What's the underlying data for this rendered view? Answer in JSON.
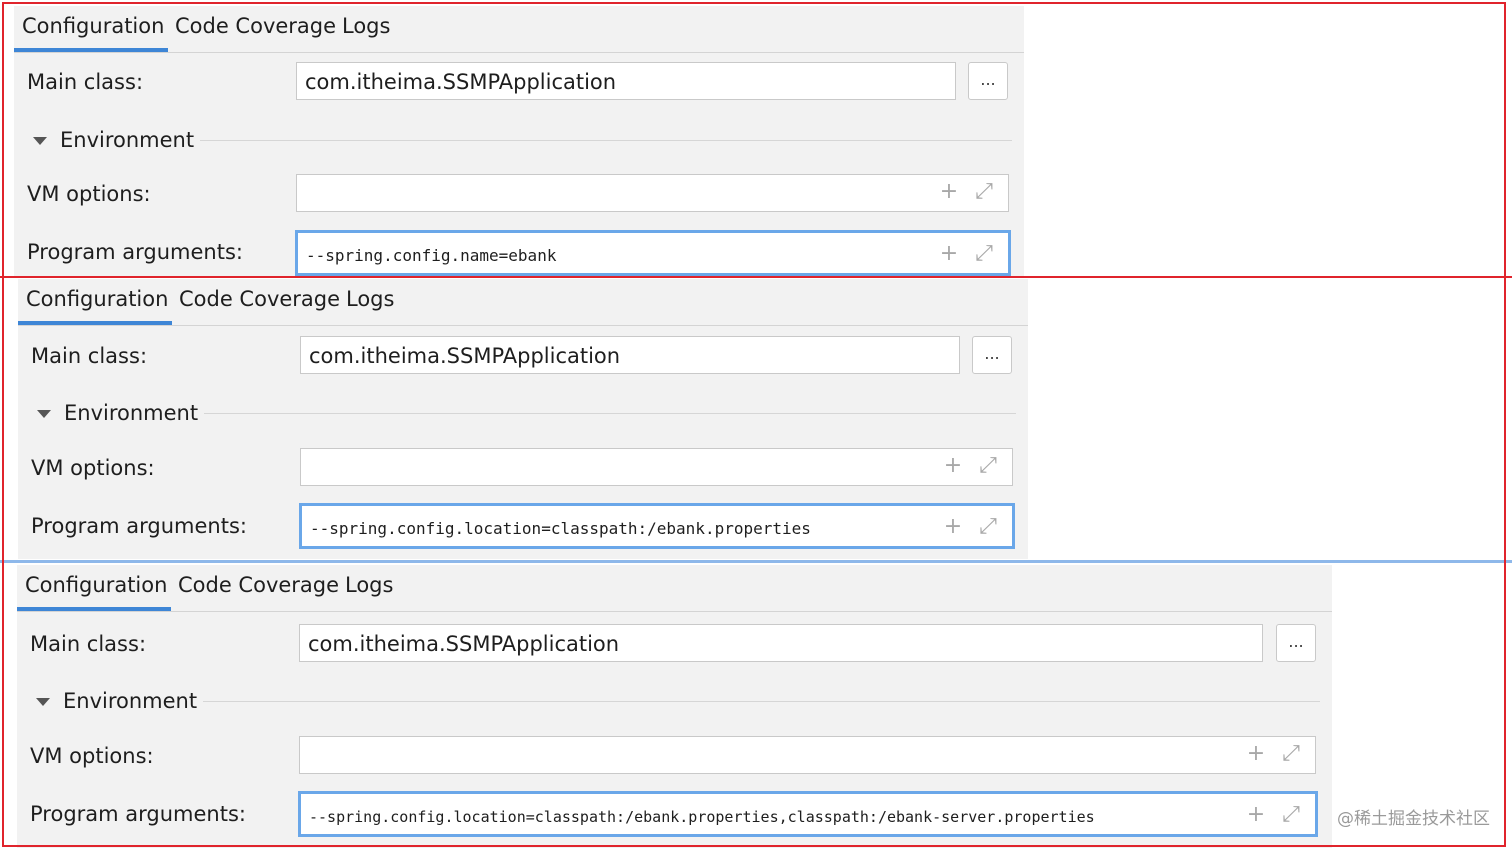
{
  "panels": [
    {
      "tabs": [
        "Configuration",
        "Code Coverage",
        "Logs"
      ],
      "main_class_label": "Main class:",
      "main_class_value": "com.itheima.SSMPApplication",
      "browse_label": "...",
      "environment_label": "Environment",
      "vm_options_label": "VM options:",
      "vm_options_value": "",
      "program_arguments_label": "Program arguments:",
      "program_arguments_value": "--spring.config.name=ebank"
    },
    {
      "tabs": [
        "Configuration",
        "Code Coverage",
        "Logs"
      ],
      "main_class_label": "Main class:",
      "main_class_value": "com.itheima.SSMPApplication",
      "browse_label": "...",
      "environment_label": "Environment",
      "vm_options_label": "VM options:",
      "vm_options_value": "",
      "program_arguments_label": "Program arguments:",
      "program_arguments_value": "--spring.config.location=classpath:/ebank.properties"
    },
    {
      "tabs": [
        "Configuration",
        "Code Coverage",
        "Logs"
      ],
      "main_class_label": "Main class:",
      "main_class_value": "com.itheima.SSMPApplication",
      "browse_label": "...",
      "environment_label": "Environment",
      "vm_options_label": "VM options:",
      "vm_options_value": "",
      "program_arguments_label": "Program arguments:",
      "program_arguments_value": "--spring.config.location=classpath:/ebank.properties,classpath:/ebank-server.properties"
    }
  ],
  "icons": {
    "add": "plus-icon",
    "expand": "expand-icon",
    "collapse_arrow": "triangle-down-icon"
  },
  "colors": {
    "frame_border": "#e0242c",
    "tab_underline": "#3e86d6",
    "focus_border": "#6aa7e9"
  },
  "watermark": "@稀土掘金技术社区"
}
